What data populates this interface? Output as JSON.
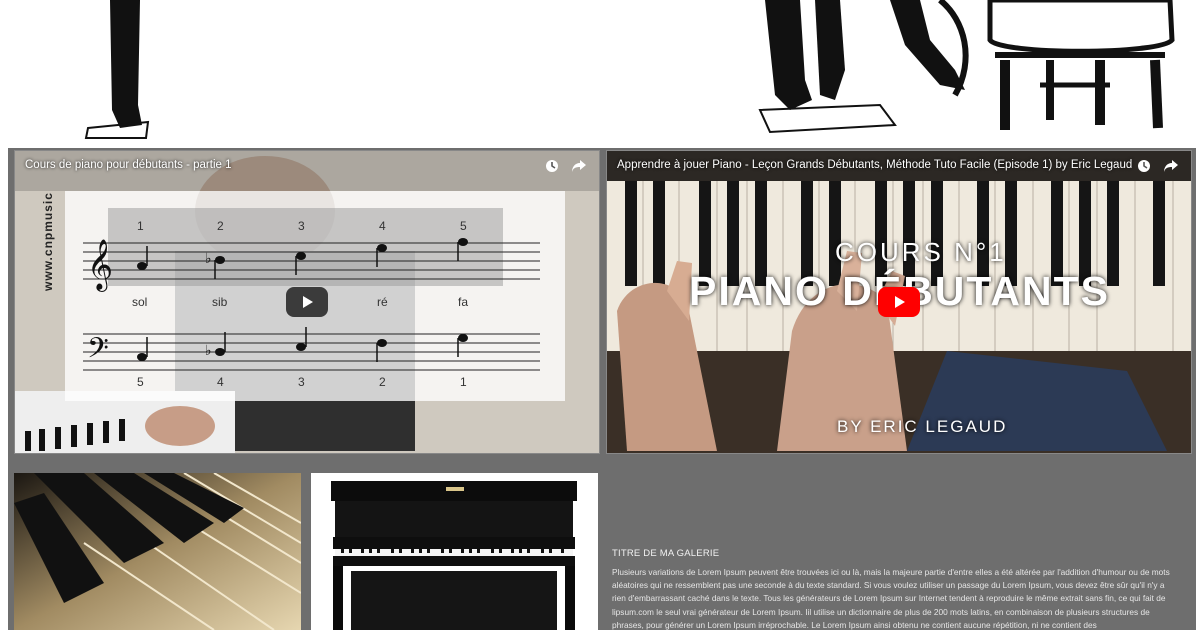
{
  "videos": [
    {
      "title": "Cours de piano pour débutants - partie 1",
      "watermark": "www.cnpmusic",
      "finger_numbers_top": [
        "1",
        "2",
        "3",
        "4",
        "5"
      ],
      "note_names": [
        "sol",
        "sib",
        "ré",
        "fa"
      ],
      "finger_numbers_bottom": [
        "5",
        "4",
        "3",
        "2",
        "1"
      ],
      "icons": [
        "clock-icon",
        "share-icon",
        "play-icon"
      ]
    },
    {
      "title": "Apprendre à jouer Piano - Leçon Grands Débutants, Méthode Tuto Facile (Episode 1) by Eric Legaud",
      "overlay_line1": "COURS N°1",
      "overlay_line2": "PIANO DÉBUTANTS",
      "overlay_line3": "BY ERIC LEGAUD",
      "icons": [
        "clock-icon",
        "share-icon",
        "youtube-play-icon"
      ]
    }
  ],
  "gallery": {
    "title": "TITRE DE MA GALERIE",
    "text": "Plusieurs variations de Lorem Ipsum peuvent être trouvées ici ou là, mais la majeure partie d'entre elles a été altérée par l'addition d'humour ou de mots aléatoires qui ne ressemblent pas une seconde à du texte standard. Si vous voulez utiliser un passage du Lorem Ipsum, vous devez être sûr qu'il n'y a rien d'embarrassant caché dans le texte. Tous les générateurs de Lorem Ipsum sur Internet tendent à reproduire le même extrait sans fin, ce qui fait de lipsum.com le seul vrai générateur de Lorem Ipsum. Iil utilise un dictionnaire de plus de 200 mots latins, en combinaison de plusieurs structures de phrases, pour générer un Lorem Ipsum irréprochable. Le Lorem Ipsum ainsi obtenu ne contient aucune répétition, ni ne contient des"
  },
  "colors": {
    "band": "#6e6e6e",
    "youtube_red": "#ff0000"
  }
}
